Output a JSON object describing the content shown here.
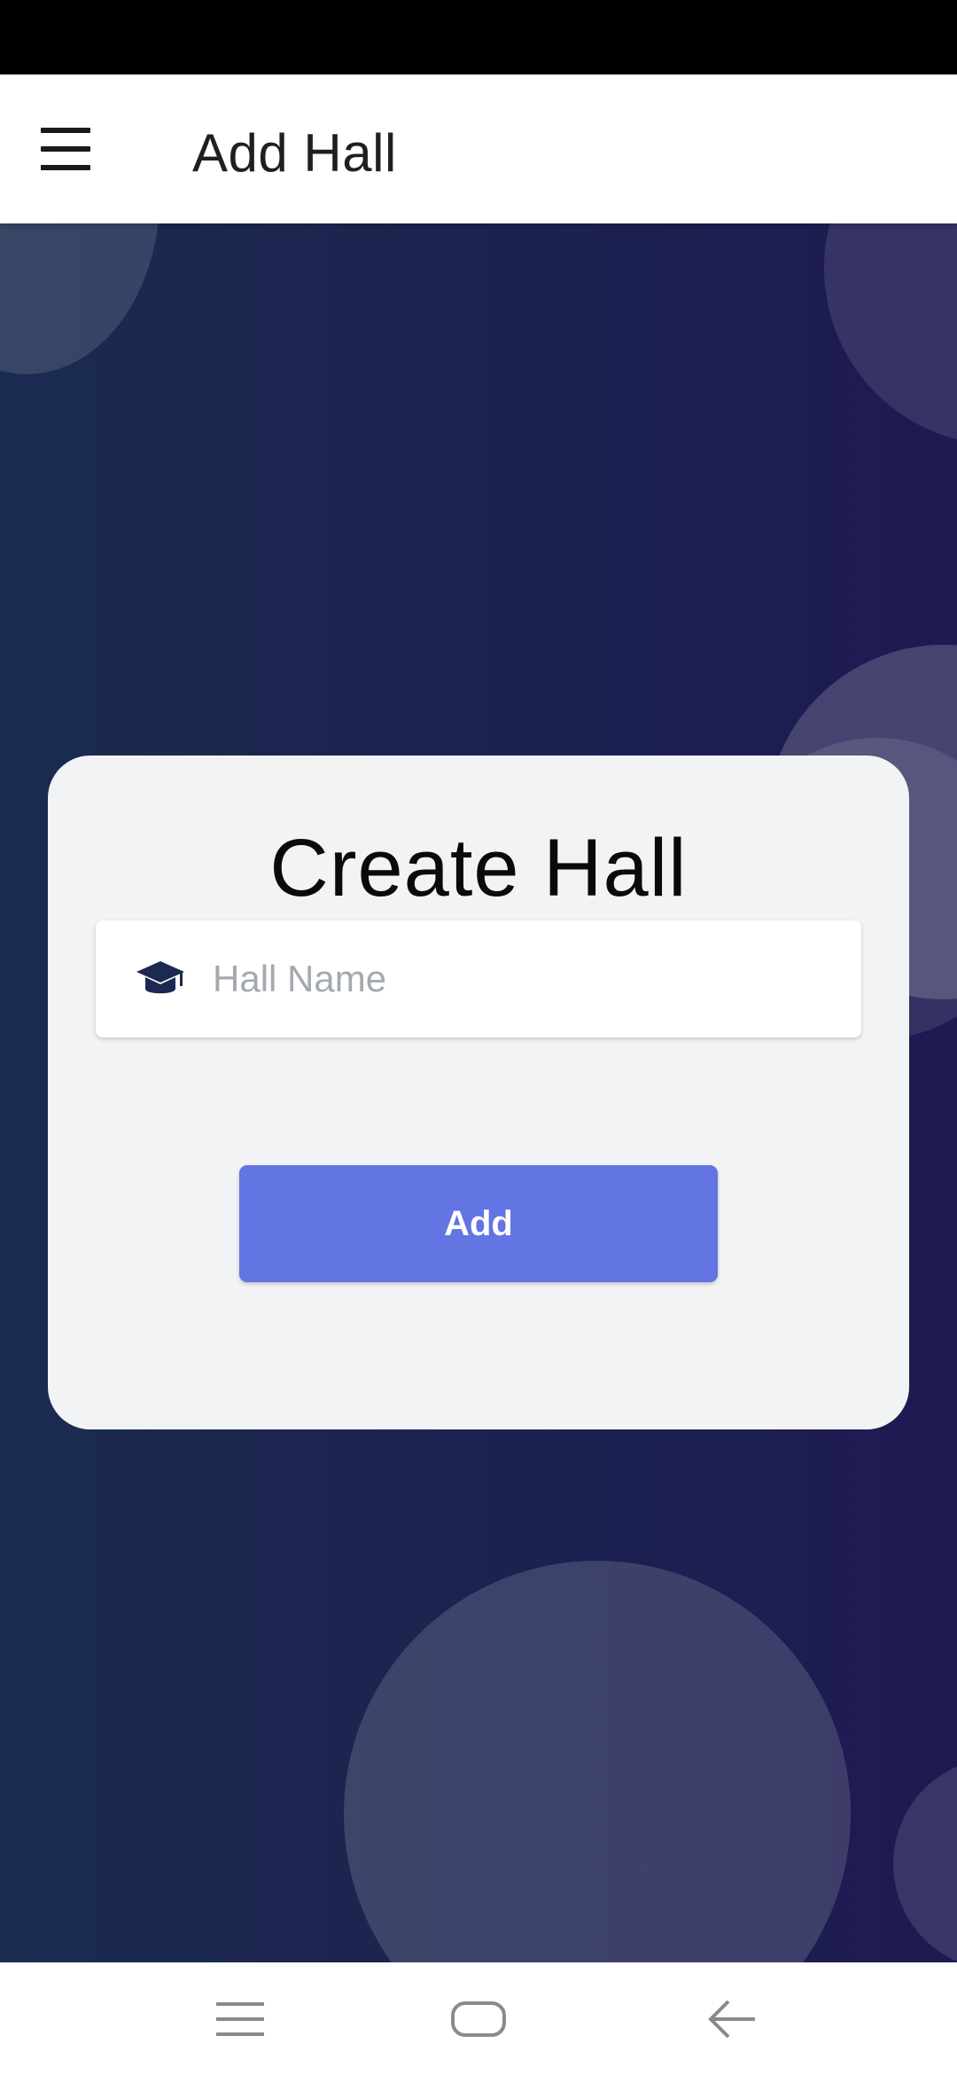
{
  "app_bar": {
    "title": "Add Hall",
    "menu_icon": "hamburger-menu-icon"
  },
  "card": {
    "title": "Create Hall",
    "hall_name_input": {
      "value": "",
      "placeholder": "Hall Name",
      "icon": "graduation-cap-icon"
    },
    "add_button_label": "Add"
  },
  "colors": {
    "background_start": "#1b2b50",
    "background_end": "#1e1a52",
    "card": "#f2f3f5",
    "button": "#6374e3",
    "icon": "#1c2950"
  },
  "nav_bar": {
    "recents_icon": "recents-icon",
    "home_icon": "home-icon",
    "back_icon": "back-arrow-icon"
  }
}
